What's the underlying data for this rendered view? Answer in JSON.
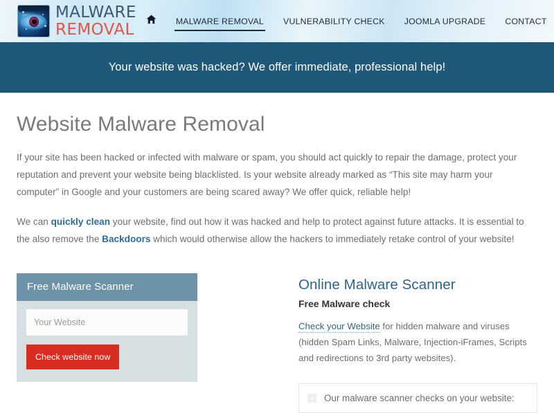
{
  "header": {
    "brand": {
      "logo_icon": "eye-logo-icon",
      "line1": "MALWARE",
      "line2": "REMOVAL",
      "line1_color": "#3f5872",
      "line2_color": "#e0564a"
    },
    "nav": {
      "home_icon": "home-icon",
      "search_icon": "search-icon",
      "items": [
        {
          "label": "MALWARE REMOVAL",
          "active": true
        },
        {
          "label": "VULNERABILITY CHECK",
          "active": false
        },
        {
          "label": "JOOMLA UPGRADE",
          "active": false
        },
        {
          "label": "CONTACT",
          "active": false
        }
      ]
    }
  },
  "banner": {
    "text": "Your website was hacked? We offer immediate, professional help!",
    "background": "#1f5878",
    "text_color": "#ffffff"
  },
  "main": {
    "title": "Website Malware Removal",
    "paragraph1": "If your site has been hacked or infected with malware or spam, you should act quickly to repair the damage, protect your reputation and prevent your website being blacklisted. Is your website already marked as “This site may harm your computer” in Google and your customers are being scared away? We offer quick, reliable help!",
    "paragraph2": {
      "part1": "We can ",
      "link1": "quickly clean",
      "part2": " your website, find out how it was hacked and help to protect against future attacks. It is essential to the also remove the ",
      "link2": "Backdoors",
      "part3": " which would otherwise allow the hackers to immediately retake control of your website!"
    }
  },
  "scanner_widget": {
    "title": "Free Malware Scanner",
    "input_placeholder": "Your Website",
    "input_value": "",
    "button_label": "Check website now",
    "header_color": "#6c93a8",
    "body_color": "#d7dfe2",
    "button_color": "#da2d22"
  },
  "scanner_info": {
    "heading": "Online Malware Scanner",
    "heading_color": "#2d6489",
    "subheading": "Free Malware check",
    "description": {
      "link": "Check your Website",
      "rest": " for hidden malware and viruses (hidden Spam Links, Malware, Injection-iFrames, Scripts and redirections to 3rd party websites)."
    },
    "accordion": {
      "icon": "plus-icon",
      "label": "Our malware scanner checks on your website:"
    }
  }
}
